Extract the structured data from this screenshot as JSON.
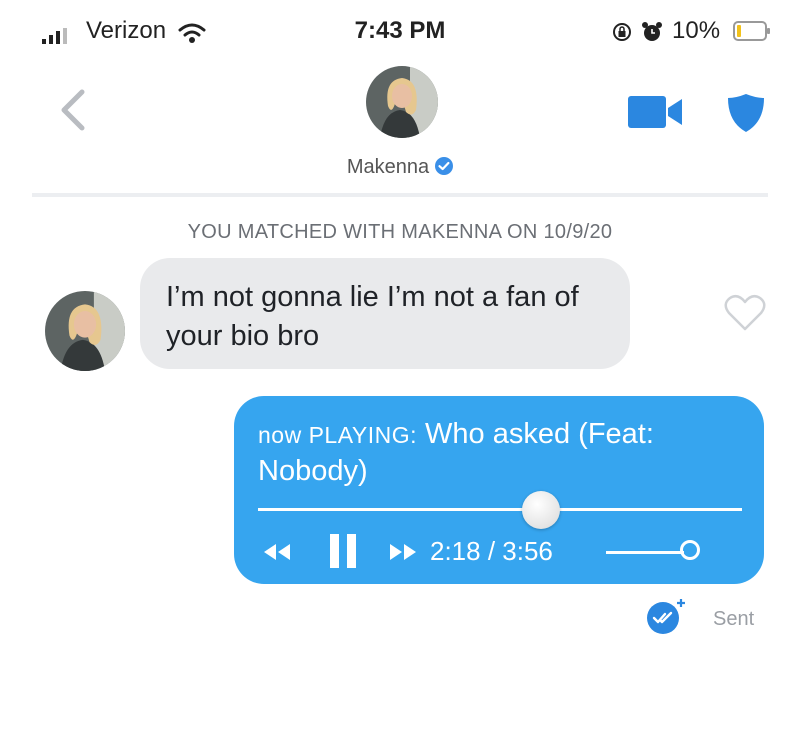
{
  "status_bar": {
    "carrier": "Verizon",
    "time": "7:43 PM",
    "battery": "10%",
    "icons": [
      "signal-icon",
      "wifi-icon",
      "rotation-lock-icon",
      "alarm-icon",
      "battery-icon"
    ]
  },
  "header": {
    "name": "Makenna",
    "icons": [
      "back-chevron-icon",
      "verified-badge-icon",
      "video-call-icon",
      "shield-icon"
    ]
  },
  "conversation": {
    "matched_banner": "YOU MATCHED WITH MAKENNA ON 10/9/20",
    "incoming": {
      "text": "I’m not gonna lie I’m not a fan of your bio bro",
      "like_icon": "heart-outline-icon"
    },
    "outgoing": {
      "prefix": "now PLAYING:",
      "title": "Who asked (Feat: Nobody)",
      "time": "2:18 / 3:56",
      "progress_fraction": 0.585,
      "controls": [
        "rewind-icon",
        "pause-icon",
        "fast-forward-icon"
      ],
      "status": "Sent"
    }
  },
  "colors": {
    "accent": "#36a5ef",
    "icon_blue": "#2b87e0",
    "incoming_bubble": "#e9eaec",
    "verified": "#3a8fe8"
  }
}
